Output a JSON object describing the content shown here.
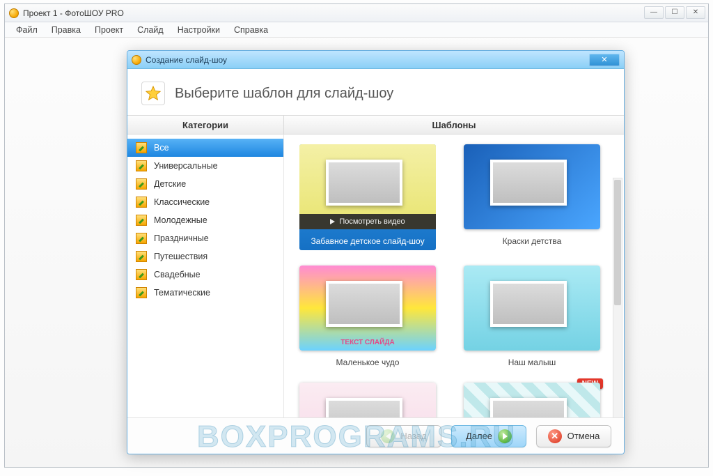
{
  "main_window": {
    "title": "Проект 1 - ФотоШОУ PRO",
    "menu": [
      "Файл",
      "Правка",
      "Проект",
      "Слайд",
      "Настройки",
      "Справка"
    ],
    "win_controls": {
      "min": "—",
      "max": "☐",
      "close": "✕"
    }
  },
  "dialog": {
    "title": "Создание слайд-шоу",
    "close_glyph": "✕",
    "heading": "Выберите шаблон для слайд-шоу",
    "columns": {
      "categories": "Категории",
      "templates": "Шаблоны"
    },
    "categories": [
      {
        "label": "Все",
        "selected": true
      },
      {
        "label": "Универсальные"
      },
      {
        "label": "Детские"
      },
      {
        "label": "Классические"
      },
      {
        "label": "Молодежные"
      },
      {
        "label": "Праздничные"
      },
      {
        "label": "Путешествия"
      },
      {
        "label": "Свадебные"
      },
      {
        "label": "Тематические"
      }
    ],
    "preview_label": "Посмотреть видео",
    "templates": [
      {
        "title": "Забавное детское слайд-шоу",
        "selected": true,
        "bg": "bg1",
        "text_overlay": ""
      },
      {
        "title": "Краски детства",
        "bg": "bg2"
      },
      {
        "title": "Маленькое чудо",
        "bg": "bg3",
        "text_overlay": "ТЕКСТ СЛАЙДА"
      },
      {
        "title": "Наш малыш",
        "bg": "bg4"
      },
      {
        "title": "",
        "bg": "bg5"
      },
      {
        "title": "",
        "bg": "bg6",
        "new": true
      }
    ],
    "new_badge": "NEW",
    "buttons": {
      "back": "Назад",
      "next": "Далее",
      "cancel": "Отмена"
    }
  },
  "watermark": "BOXPROGRAMS.RU"
}
